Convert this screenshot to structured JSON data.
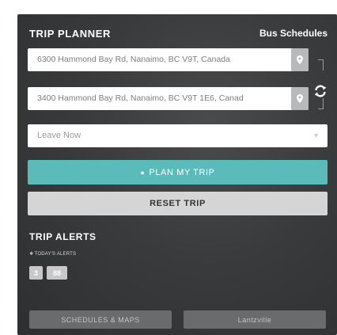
{
  "header": {
    "title": "TRIP PLANNER",
    "link": "Bus Schedules"
  },
  "from": {
    "value": "6300 Hammond Bay Rd, Nanaimo, BC V9T, Canada"
  },
  "to": {
    "value": "3400 Hammond Bay Rd, Nanaimo, BC V9T 1E6, Canad"
  },
  "depart": {
    "value": "Leave Now"
  },
  "buttons": {
    "plan": "PLAN MY TRIP",
    "reset": "RESET TRIP"
  },
  "alerts": {
    "title": "TRIP ALERTS",
    "subtitle": "TODAY'S ALERTS",
    "routes": [
      "3",
      "88"
    ]
  },
  "footer": {
    "schedules": "SCHEDULES & MAPS",
    "right": "Lantzville"
  },
  "colors": {
    "accent": "#5bbbbb",
    "panel": "#3a3b3c"
  }
}
